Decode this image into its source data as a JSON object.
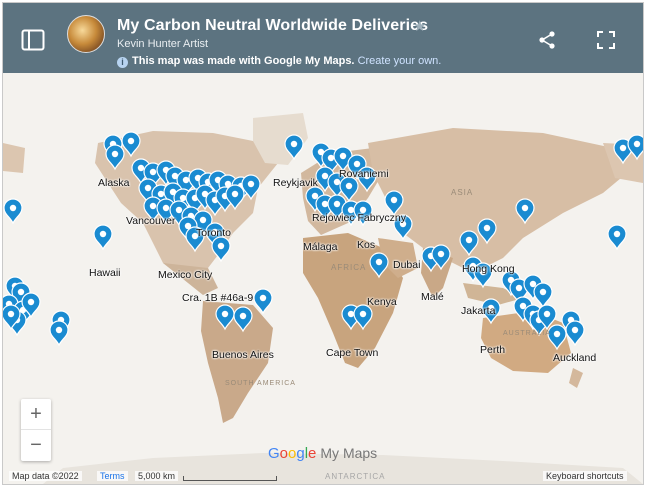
{
  "header": {
    "title": "My Carbon Neutral Worldwide Deliveries",
    "author": "Kevin Hunter Artist",
    "info_icon": "i",
    "note_text": "This map was made with Google My Maps.",
    "note_link": "Create your own.",
    "star_glyph": "★",
    "icons": [
      "panel-toggle-icon",
      "star-icon",
      "share-icon",
      "fullscreen-icon"
    ]
  },
  "map": {
    "places": [
      "Alaska",
      "Vancouver",
      "Toronto",
      "Mexico City",
      "Hawaii",
      "Cra. 1B #46a-9",
      "Buenos Aires",
      "Reykjavik",
      "Rovaniemi",
      "Rejowiec Fabryczny",
      "Málaga",
      "Kos",
      "Dubai",
      "Kenya",
      "Malé",
      "Cape Town",
      "Hong Kong",
      "Jakarta",
      "Perth",
      "Auckland"
    ],
    "regions": [
      "ASIA",
      "AFRICA",
      "SOUTH AMERICA",
      "AUSTRALIA",
      "ANTARCTICA"
    ],
    "marker_color": "#1a8bd1",
    "zoom_in": "+",
    "zoom_out": "−"
  },
  "logo": {
    "google": [
      "G",
      "o",
      "o",
      "g",
      "l",
      "e"
    ],
    "product": "My Maps"
  },
  "footer": {
    "map_data": "Map data ©2022",
    "terms": "Terms",
    "scale": "5,000 km",
    "shortcuts": "Keyboard shortcuts"
  }
}
